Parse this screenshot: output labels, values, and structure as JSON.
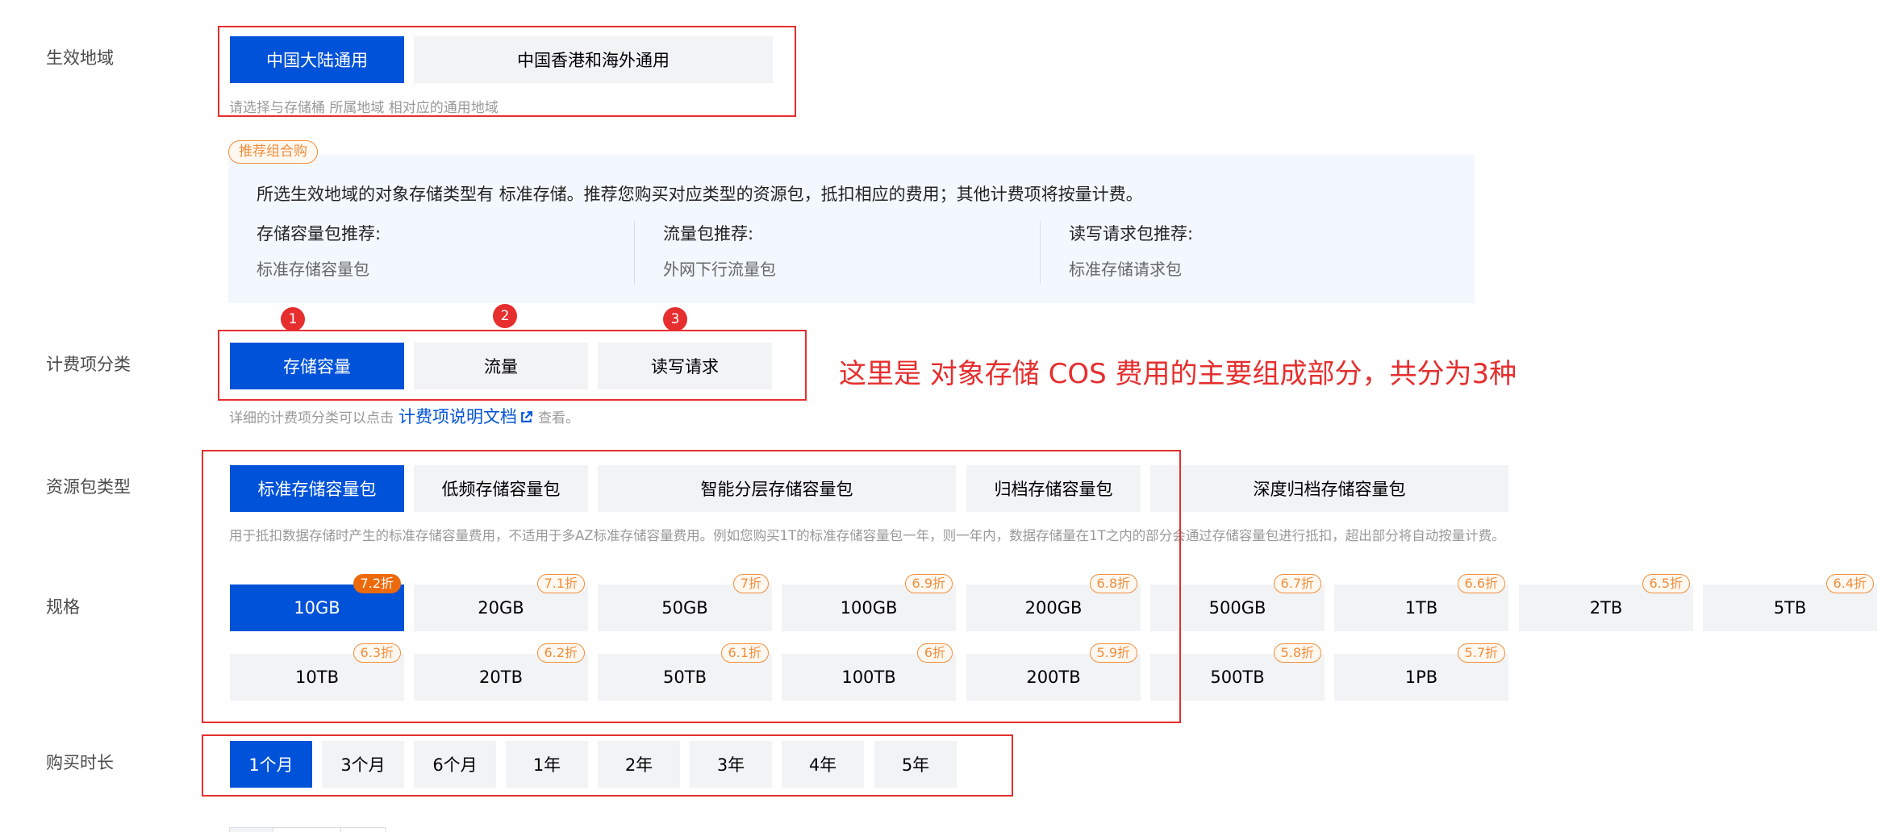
{
  "region": {
    "label": "生效地域",
    "options": [
      "中国大陆通用",
      "中国香港和海外通用"
    ],
    "selected": 0,
    "hint": "请选择与存储桶 所属地域 相对应的通用地域"
  },
  "recommend": {
    "tag": "推荐组合购",
    "description": "所选生效地域的对象存储类型有 标准存储。推荐您购买对应类型的资源包，抵扣相应的费用；其他计费项将按量计费。",
    "columns": [
      {
        "title": "存储容量包推荐:",
        "value": "标准存储容量包"
      },
      {
        "title": "流量包推荐:",
        "value": "外网下行流量包"
      },
      {
        "title": "读写请求包推荐:",
        "value": "标准存储请求包"
      }
    ]
  },
  "billing": {
    "label": "计费项分类",
    "options": [
      "存储容量",
      "流量",
      "读写请求"
    ],
    "badges": [
      "1",
      "2",
      "3"
    ],
    "selected": 0,
    "hint_prefix": "详细的计费项分类可以点击",
    "link_text": "计费项说明文档",
    "hint_suffix": "查看。",
    "annotation": "这里是 对象存储 COS 费用的主要组成部分，共分为3种"
  },
  "package": {
    "label": "资源包类型",
    "options": [
      "标准存储容量包",
      "低频存储容量包",
      "智能分层存储容量包",
      "归档存储容量包",
      "深度归档存储容量包"
    ],
    "selected": 0,
    "hint": "用于抵扣数据存储时产生的标准存储容量费用，不适用于多AZ标准存储容量费用。例如您购买1T的标准存储容量包一年，则一年内，数据存储量在1T之内的部分会通过存储容量包进行抵扣，超出部分将自动按量计费。"
  },
  "spec": {
    "label": "规格",
    "options": [
      {
        "size": "10GB",
        "discount": "7.2折"
      },
      {
        "size": "20GB",
        "discount": "7.1折"
      },
      {
        "size": "50GB",
        "discount": "7折"
      },
      {
        "size": "100GB",
        "discount": "6.9折"
      },
      {
        "size": "200GB",
        "discount": "6.8折"
      },
      {
        "size": "500GB",
        "discount": "6.7折"
      },
      {
        "size": "1TB",
        "discount": "6.6折"
      },
      {
        "size": "2TB",
        "discount": "6.5折"
      },
      {
        "size": "5TB",
        "discount": "6.4折"
      },
      {
        "size": "10TB",
        "discount": "6.3折"
      },
      {
        "size": "20TB",
        "discount": "6.2折"
      },
      {
        "size": "50TB",
        "discount": "6.1折"
      },
      {
        "size": "100TB",
        "discount": "6折"
      },
      {
        "size": "200TB",
        "discount": "5.9折"
      },
      {
        "size": "500TB",
        "discount": "5.8折"
      },
      {
        "size": "1PB",
        "discount": "5.7折"
      }
    ],
    "selected": 0
  },
  "duration": {
    "label": "购买时长",
    "options": [
      "1个月",
      "3个月",
      "6个月",
      "1年",
      "2年",
      "3年",
      "4年",
      "5年"
    ],
    "selected": 0
  },
  "colors": {
    "primary": "#0052d9",
    "annotation_red": "#e62e2e",
    "discount_orange": "#f08e3d",
    "option_bg": "#f2f3f5",
    "panel_bg": "#f3f7fe"
  }
}
